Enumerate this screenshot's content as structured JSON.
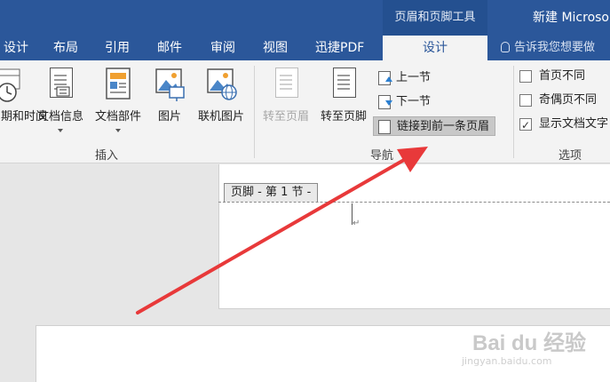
{
  "titlebar": {
    "context_title": "页眉和页脚工具",
    "window_title": "新建 Microso"
  },
  "tabs": [
    {
      "label": "设计"
    },
    {
      "label": "布局"
    },
    {
      "label": "引用"
    },
    {
      "label": "邮件"
    },
    {
      "label": "审阅"
    },
    {
      "label": "视图"
    },
    {
      "label": "迅捷PDF"
    },
    {
      "label": "设计",
      "active": true
    }
  ],
  "tell_me": "告诉我您想要做",
  "ribbon": {
    "insert_group": {
      "label": "插入",
      "buttons": [
        {
          "label": "日期和时间",
          "icon": "calendar-clock-icon"
        },
        {
          "label": "文档信息",
          "icon": "document-info-icon",
          "dropdown": true
        },
        {
          "label": "文档部件",
          "icon": "quick-parts-icon",
          "dropdown": true
        },
        {
          "label": "图片",
          "icon": "picture-icon"
        },
        {
          "label": "联机图片",
          "icon": "online-picture-icon"
        }
      ]
    },
    "navigation_group": {
      "label": "导航",
      "buttons": [
        {
          "label": "转至页眉",
          "icon": "goto-header-icon",
          "disabled": true
        },
        {
          "label": "转至页脚",
          "icon": "goto-footer-icon"
        }
      ],
      "small_buttons": [
        {
          "label": "上一节",
          "icon": "previous-section-icon"
        },
        {
          "label": "下一节",
          "icon": "next-section-icon"
        },
        {
          "label": "链接到前一条页眉",
          "icon": "link-to-previous-icon",
          "highlighted": true
        }
      ]
    },
    "options_group": {
      "label": "选项",
      "checkboxes": [
        {
          "label": "首页不同",
          "checked": false
        },
        {
          "label": "奇偶页不同",
          "checked": false
        },
        {
          "label": "显示文档文字",
          "checked": true
        }
      ]
    }
  },
  "document": {
    "footer_tab": "页脚 - 第 1 节 -",
    "paragraph_mark": "↵"
  },
  "watermark": {
    "brand": "Bai du 经验",
    "url": "jingyan.baidu.com"
  },
  "colors": {
    "ribbon_blue": "#2b579a",
    "arrow_red": "#e8393a"
  }
}
